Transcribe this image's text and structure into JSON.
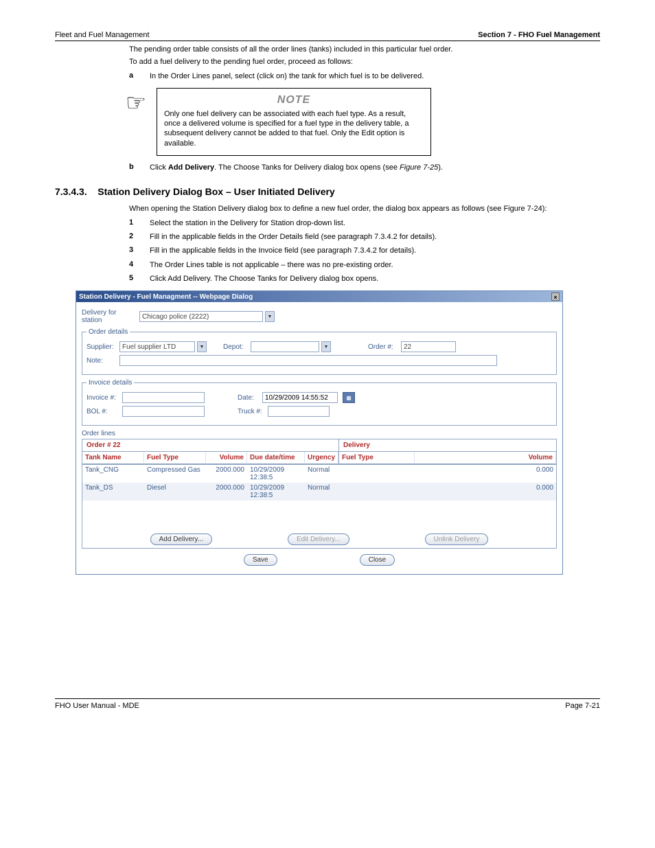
{
  "header": {
    "left": "Fleet and Fuel Management",
    "right": "Section  7 - FHO Fuel Management"
  },
  "intro": {
    "line1": "The pending order table consists of all the order lines (tanks) included in this particular fuel order.",
    "line2": "To add a fuel delivery to the pending fuel order, proceed as follows:"
  },
  "step_a": {
    "num": "a",
    "text": "In the Order Lines panel, select (click on) the tank for which fuel is to be delivered."
  },
  "note": {
    "title": "NOTE",
    "text": "Only one fuel delivery can be associated with each fuel type. As a result, once a delivered volume is specified for a fuel type in the delivery table, a subsequent delivery cannot be added to that fuel. Only the Edit option is available."
  },
  "step_b": {
    "num": "b",
    "text_before": "Click ",
    "bold": "Add Delivery",
    "text_after": ". The Choose Tanks for Delivery dialog box opens (see ",
    "link": "Figure 7-25",
    "after_link": ")."
  },
  "subsection": {
    "num": "7.3.4.3.",
    "title": "Station Delivery Dialog Box – User Initiated Delivery"
  },
  "sub_text": "When opening the Station Delivery dialog box to define a new fuel order, the dialog box appears as follows (see Figure 7-24):",
  "sub_steps": {
    "s1": {
      "num": "1",
      "text": "Select the station in the Delivery for Station drop-down list."
    },
    "s2": {
      "num": "2",
      "text": "Fill in the applicable fields in the Order Details field (see paragraph 7.3.4.2 for details)."
    },
    "s3": {
      "num": "3",
      "text": "Fill in the applicable fields in the Invoice field (see paragraph 7.3.4.2 for details)."
    },
    "s4": {
      "num": "4",
      "text": "The Order Lines table is not applicable – there was no pre-existing order."
    },
    "s5": {
      "num": "5",
      "text": "Click Add Delivery. The Choose Tanks for Delivery dialog box opens."
    }
  },
  "dialog": {
    "title": "Station Delivery - Fuel Managment -- Webpage Dialog",
    "delivery_for_station_lbl": "Delivery for station",
    "station_value": "Chicago police (2222)",
    "order_details_legend": "Order details",
    "supplier_lbl": "Supplier:",
    "supplier_value": "Fuel supplier LTD",
    "depot_lbl": "Depot:",
    "ordernum_lbl": "Order #:",
    "ordernum_value": "22",
    "note_lbl": "Note:",
    "invoice_legend": "Invoice details",
    "invoice_lbl": "Invoice #:",
    "date_lbl": "Date:",
    "date_value": "10/29/2009 14:55:52",
    "bol_lbl": "BOL #:",
    "truck_lbl": "Truck #:",
    "order_lines_lbl": "Order lines",
    "order_section": "Order # 22",
    "delivery_section": "Delivery",
    "headers": {
      "tank": "Tank Name",
      "fuel": "Fuel Type",
      "volume": "Volume",
      "due": "Due date/time",
      "urgency": "Urgency",
      "dfuel": "Fuel Type",
      "dvolume": "Volume"
    },
    "rows": [
      {
        "tank": "Tank_CNG",
        "fuel": "Compressed Gas",
        "volume": "2000.000",
        "due": "10/29/2009 12:38:5",
        "urgency": "Normal",
        "dvol": "0.000"
      },
      {
        "tank": "Tank_DS",
        "fuel": "Diesel",
        "volume": "2000.000",
        "due": "10/29/2009 12:38:5",
        "urgency": "Normal",
        "dvol": "0.000"
      }
    ],
    "buttons": {
      "add": "Add Delivery...",
      "edit": "Edit Delivery...",
      "unlink": "Unlink Delivery",
      "save": "Save",
      "close": "Close"
    }
  },
  "footer": {
    "left": "FHO User Manual - MDE",
    "right": "Page 7-21"
  }
}
